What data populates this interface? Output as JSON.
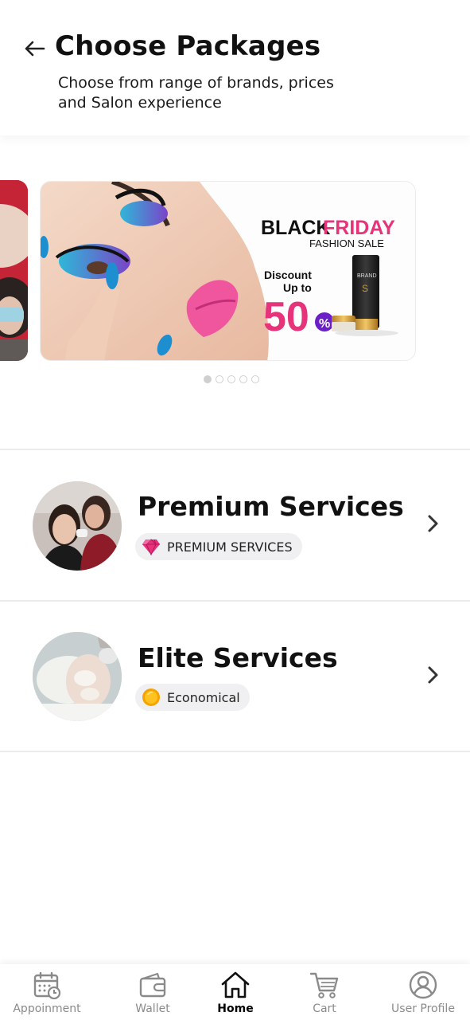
{
  "header": {
    "title": "Choose Packages",
    "subtitle": "Choose from range of brands, prices and Salon experience"
  },
  "carousel": {
    "banner": {
      "headline_black": "BLACK",
      "headline_pink": "FRIDAY",
      "tagline": "FASHION SALE",
      "discount_line1": "Discount",
      "discount_line2": "Up to",
      "discount_value": "50",
      "discount_symbol": "%",
      "product_brand": "BRAND",
      "product_letter": "S"
    },
    "dot_count": 5,
    "active_index": 0
  },
  "services": [
    {
      "name": "Premium Services",
      "badge_label": "PREMIUM SERVICES",
      "badge_icon": "diamond-icon",
      "badge_color": "#e6337a"
    },
    {
      "name": "Elite Services",
      "badge_label": "Economical",
      "badge_icon": "coin-icon",
      "badge_color": "#f5a300"
    }
  ],
  "bottom_nav": {
    "items": [
      {
        "label": "Appoinment",
        "icon": "calendar-icon",
        "active": false
      },
      {
        "label": "Wallet",
        "icon": "wallet-icon",
        "active": false
      },
      {
        "label": "Home",
        "icon": "home-icon",
        "active": true
      },
      {
        "label": "Cart",
        "icon": "cart-icon",
        "active": false
      },
      {
        "label": "User Profile",
        "icon": "user-profile-icon",
        "active": false
      }
    ]
  },
  "colors": {
    "pink_accent": "#e6337a",
    "divider": "#ebebeb",
    "chip_bg": "#f0f0f2",
    "inactive_nav": "#8a8a8a"
  }
}
